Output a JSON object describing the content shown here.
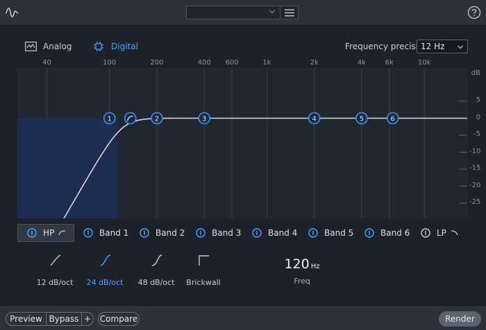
{
  "header": {
    "preset_value": "",
    "icons": {
      "app": "waveform-icon",
      "caret": "chevron-down-icon",
      "menu": "hamburger-menu-icon",
      "help": "help-icon"
    }
  },
  "modes": {
    "analog_label": "Analog",
    "digital_label": "Digital",
    "selected": "Digital"
  },
  "frequency_precision": {
    "label": "Frequency precision",
    "value": "12 Hz"
  },
  "graph": {
    "x_ticks": [
      {
        "label": "40",
        "hz": 40
      },
      {
        "label": "100",
        "hz": 100
      },
      {
        "label": "200",
        "hz": 200
      },
      {
        "label": "400",
        "hz": 400
      },
      {
        "label": "600",
        "hz": 600
      },
      {
        "label": "1k",
        "hz": 1000
      },
      {
        "label": "2k",
        "hz": 2000
      },
      {
        "label": "4k",
        "hz": 4000
      },
      {
        "label": "6k",
        "hz": 6000
      },
      {
        "label": "10k",
        "hz": 10000
      }
    ],
    "y_unit": "dB",
    "y_ticks": [
      {
        "label": "5",
        "db": 5
      },
      {
        "label": "0",
        "db": 0
      },
      {
        "label": "-5",
        "db": -5
      },
      {
        "label": "-10",
        "db": -10
      },
      {
        "label": "-15",
        "db": -15
      },
      {
        "label": "-20",
        "db": -20
      },
      {
        "label": "-25",
        "db": -25
      }
    ],
    "nodes": [
      {
        "label": "1",
        "hz": 100
      },
      {
        "label": "2",
        "hz": 200
      },
      {
        "label": "3",
        "hz": 400
      },
      {
        "label": "4",
        "hz": 2000
      },
      {
        "label": "5",
        "hz": 4000
      },
      {
        "label": "6",
        "hz": 6300
      }
    ],
    "highpass_hz": 120,
    "colors": {
      "bg": "#1f2731",
      "grid": "#39424f",
      "curve": "#d5d9de",
      "fill": "#1e2d55",
      "node": "#4d8fe0"
    }
  },
  "tabs": [
    {
      "label": "HP",
      "active": true,
      "shape": "highpass-shape-icon"
    },
    {
      "label": "Band 1",
      "active": false
    },
    {
      "label": "Band 2",
      "active": false
    },
    {
      "label": "Band 3",
      "active": false
    },
    {
      "label": "Band 4",
      "active": false
    },
    {
      "label": "Band 5",
      "active": false
    },
    {
      "label": "Band 6",
      "active": false
    },
    {
      "label": "LP",
      "active": false,
      "shape": "lowpass-shape-icon"
    }
  ],
  "slopes": [
    {
      "label": "12 dB/oct",
      "selected": false
    },
    {
      "label": "24 dB/oct",
      "selected": true
    },
    {
      "label": "48 dB/oct",
      "selected": false
    },
    {
      "label": "Brickwall",
      "selected": false
    }
  ],
  "freq": {
    "value": "120",
    "unit": "Hz",
    "label": "Freq"
  },
  "footer": {
    "preview": "Preview",
    "bypass": "Bypass",
    "plus": "+",
    "compare": "Compare",
    "render": "Render"
  }
}
